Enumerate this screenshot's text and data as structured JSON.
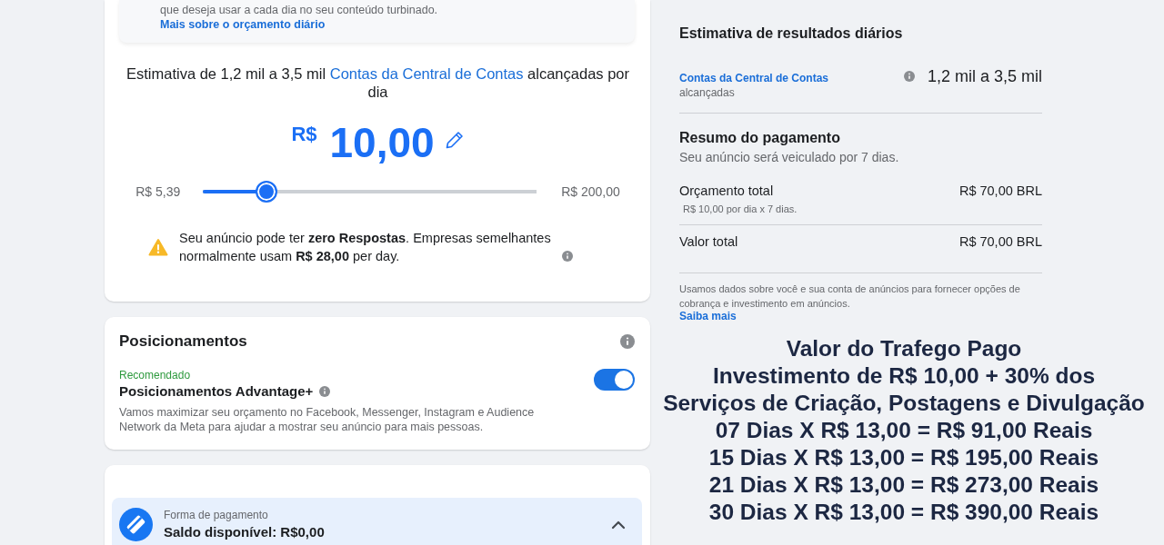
{
  "budget": {
    "notice": {
      "text": "que deseja usar a cada dia no seu conteúdo turbinado.",
      "link": "Mais sobre o orçamento diário"
    },
    "estimate": {
      "before": "Estimativa de 1,2 mil a 3,5 mil",
      "link": "Contas da Central de Contas",
      "after": "alcançadas por dia"
    },
    "amount": {
      "currency": "R$",
      "value": "10,00"
    },
    "slider": {
      "min": "R$ 5,39",
      "max": "R$ 200,00",
      "level": 0.19
    },
    "warning": "Seu anúncio pode ter **zero Respostas**. Empresas semelhantes normalmente usam **R$ 28,00** per day."
  },
  "placements": {
    "title": "Posicionamentos",
    "tag": "Recomendado",
    "option": "Posicionamentos Advantage+",
    "description": "Vamos maximizar seu orçamento no Facebook, Messenger, Instagram e Audience Network da Meta para ajudar a mostrar seu anúncio para mais pessoas.",
    "on": true
  },
  "payment_method": {
    "label": "Forma de pagamento",
    "value": "Saldo disponível: R$0,00",
    "expanded": true
  },
  "daily_results": {
    "title": "Estimativa de resultados diários",
    "metric": "Contas da Central de Contas",
    "metric_note": "alcançadas",
    "value": "1,2 mil a 3,5 mil"
  },
  "payment_summary": {
    "title": "Resumo do pagamento",
    "subtitle": "Seu anúncio será veiculado por 7 dias.",
    "rows": [
      {
        "label": "Orçamento total",
        "note": "R$ 10,00 por dia x 7 dias.",
        "value": "R$ 70,00 BRL"
      },
      {
        "label": "Valor total",
        "value": "R$ 70,00 BRL"
      }
    ],
    "disclaimer": "Usamos dados sobre você e sua conta de anúncios para fornecer opções de cobrança e investimento em anúncios.",
    "link": "Saiba mais"
  },
  "promo_lines": [
    "Valor do Trafego Pago",
    "Investimento de R$ 10,00 + 30% dos",
    "Serviços de Criação, Postagens e Divulgação",
    "07 Dias X R$ 13,00 = R$ 91,00 Reais",
    "15 Dias X R$ 13,00 = R$ 195,00 Reais",
    "21 Dias X R$ 13,00 = R$ 273,00 Reais",
    "30 Dias X R$ 13,00 = R$ 390,00 Reais"
  ]
}
